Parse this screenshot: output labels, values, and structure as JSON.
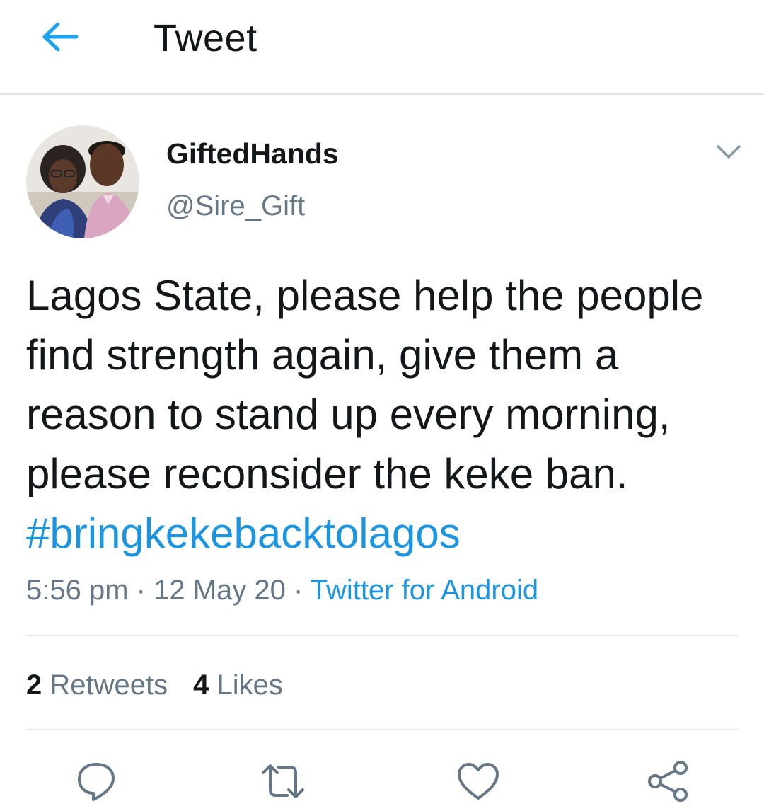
{
  "header": {
    "title": "Tweet",
    "back_icon": "arrow-left-icon",
    "accent": "#1da1f2"
  },
  "author": {
    "display_name": "GiftedHands",
    "handle": "@Sire_Gift"
  },
  "tweet": {
    "text": "Lagos State, please help the people find strength again, give them a reason to stand up every morning, please reconsider the keke ban.",
    "hashtag": "#bringkekebacktolagos",
    "time": "5:56 pm",
    "date": "12 May 20",
    "source": "Twitter for Android",
    "separator": "·"
  },
  "stats": {
    "retweets_count": "2",
    "retweets_label": "Retweets",
    "likes_count": "4",
    "likes_label": "Likes"
  },
  "actions": [
    "reply-icon",
    "retweet-icon",
    "like-icon",
    "share-icon"
  ],
  "colors": {
    "text": "#14171a",
    "secondary": "#657786",
    "link": "#1b95e0",
    "divider": "#e1e8ed"
  }
}
